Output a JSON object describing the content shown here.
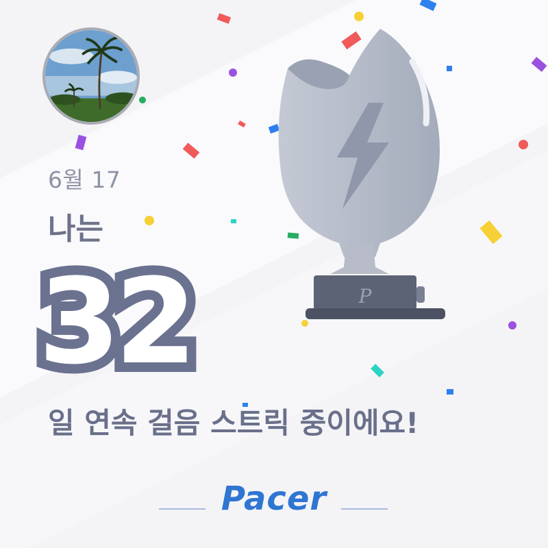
{
  "date": "6월 17",
  "streak": {
    "prefix": "나는",
    "days": "32",
    "suffix": "일 연속 걸음 스트릭 중이에요!"
  },
  "trophy": {
    "icon": "lightning-bolt-icon",
    "base_mark": "P"
  },
  "brand": {
    "name": "Pacer",
    "color": "#2f75d2"
  },
  "colors": {
    "text_primary": "#6b7290",
    "trophy": "#b9bfcc",
    "trophy_base": "#5c6375"
  }
}
